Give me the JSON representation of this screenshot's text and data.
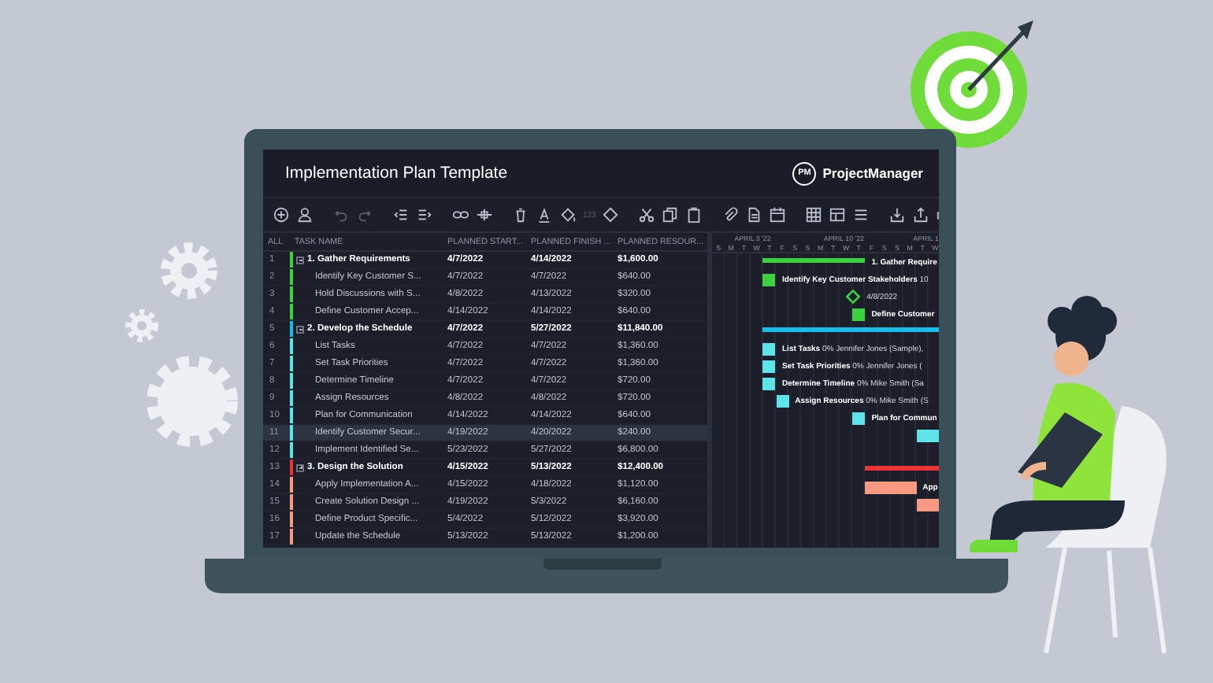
{
  "window": {
    "title": "Implementation Plan Template",
    "brand": {
      "badge": "PM",
      "name": "ProjectManager"
    }
  },
  "toolbar": {
    "number_format": "123"
  },
  "table": {
    "columns": [
      "ALL",
      "TASK NAME",
      "PLANNED START...",
      "PLANNED FINISH ...",
      "PLANNED RESOUR..."
    ],
    "rows": [
      {
        "num": "1",
        "task": "1. Gather Requirements",
        "start": "4/7/2022",
        "finish": "4/14/2022",
        "resource": "$1,600.00",
        "kind": "summary",
        "color": "#3dd13f",
        "selected": false,
        "expanded": true,
        "gantt_label": {
          "name": "1. Gather Require"
        }
      },
      {
        "num": "2",
        "task": "Identify Key Customer S...",
        "start": "4/7/2022",
        "finish": "4/7/2022",
        "resource": "$640.00",
        "kind": "task",
        "color": "#3dd13f",
        "selected": false,
        "gantt_label": {
          "name": "Identify Key Customer Stakeholders",
          "detail": "10"
        }
      },
      {
        "num": "3",
        "task": "Hold Discussions with S...",
        "start": "4/8/2022",
        "finish": "4/13/2022",
        "resource": "$320.00",
        "kind": "milestone",
        "color": "#3dd13f",
        "selected": false,
        "gantt_label": {
          "detail": "4/8/2022"
        }
      },
      {
        "num": "4",
        "task": "Define Customer Accep...",
        "start": "4/14/2022",
        "finish": "4/14/2022",
        "resource": "$640.00",
        "kind": "task",
        "color": "#3dd13f",
        "selected": false,
        "gantt_label": {
          "name": "Define Customer"
        }
      },
      {
        "num": "5",
        "task": "2. Develop the Schedule",
        "start": "4/7/2022",
        "finish": "5/27/2022",
        "resource": "$11,840.00",
        "kind": "summary",
        "color": "#1bbde6",
        "selected": false,
        "expanded": true
      },
      {
        "num": "6",
        "task": "List Tasks",
        "start": "4/7/2022",
        "finish": "4/7/2022",
        "resource": "$1,360.00",
        "kind": "task",
        "color": "#5ee3ea",
        "selected": false,
        "gantt_label": {
          "name": "List Tasks",
          "detail": "0%  Jennifer Jones (Sample),"
        }
      },
      {
        "num": "7",
        "task": "Set Task Priorities",
        "start": "4/7/2022",
        "finish": "4/7/2022",
        "resource": "$1,360.00",
        "kind": "task",
        "color": "#5ee3ea",
        "selected": false,
        "gantt_label": {
          "name": "Set Task Priorities",
          "detail": "0%  Jennifer Jones ("
        }
      },
      {
        "num": "8",
        "task": "Determine Timeline",
        "start": "4/7/2022",
        "finish": "4/7/2022",
        "resource": "$720.00",
        "kind": "task",
        "color": "#5ee3ea",
        "selected": false,
        "gantt_label": {
          "name": "Determine Timeline",
          "detail": "0%  Mike Smith (Sa"
        }
      },
      {
        "num": "9",
        "task": "Assign Resources",
        "start": "4/8/2022",
        "finish": "4/8/2022",
        "resource": "$720.00",
        "kind": "task",
        "color": "#5ee3ea",
        "selected": false,
        "gantt_label": {
          "name": "Assign Resources",
          "detail": "0%  Mike Smith (S"
        }
      },
      {
        "num": "10",
        "task": "Plan for Communication",
        "start": "4/14/2022",
        "finish": "4/14/2022",
        "resource": "$640.00",
        "kind": "task",
        "color": "#5ee3ea",
        "selected": false,
        "gantt_label": {
          "name": "Plan for Commun"
        }
      },
      {
        "num": "11",
        "task": "Identify Customer Secur...",
        "start": "4/19/2022",
        "finish": "4/20/2022",
        "resource": "$240.00",
        "kind": "task",
        "color": "#5ee3ea",
        "selected": true
      },
      {
        "num": "12",
        "task": "Implement Identified Se...",
        "start": "5/23/2022",
        "finish": "5/27/2022",
        "resource": "$6,800.00",
        "kind": "task",
        "color": "#5ee3ea",
        "selected": false
      },
      {
        "num": "13",
        "task": "3. Design the Solution",
        "start": "4/15/2022",
        "finish": "5/13/2022",
        "resource": "$12,400.00",
        "kind": "summary",
        "color": "#ee3333",
        "selected": false,
        "expanded": false
      },
      {
        "num": "14",
        "task": "Apply Implementation A...",
        "start": "4/15/2022",
        "finish": "4/18/2022",
        "resource": "$1,120.00",
        "kind": "task",
        "color": "#f89a82",
        "selected": false,
        "gantt_label": {
          "name": "App"
        }
      },
      {
        "num": "15",
        "task": "Create Solution Design ...",
        "start": "4/19/2022",
        "finish": "5/3/2022",
        "resource": "$6,160.00",
        "kind": "task",
        "color": "#f89a82",
        "selected": false
      },
      {
        "num": "16",
        "task": "Define Product Specific...",
        "start": "5/4/2022",
        "finish": "5/12/2022",
        "resource": "$3,920.00",
        "kind": "task",
        "color": "#f89a82",
        "selected": false
      },
      {
        "num": "17",
        "task": "Update the Schedule",
        "start": "5/13/2022",
        "finish": "5/13/2022",
        "resource": "$1,200.00",
        "kind": "task",
        "color": "#f89a82",
        "selected": false
      }
    ]
  },
  "gantt": {
    "months": [
      "APRIL 3 '22",
      "APRIL 10 '22",
      "APRIL 1"
    ],
    "days": [
      "S",
      "M",
      "T",
      "W",
      "T",
      "F",
      "S",
      "S",
      "M",
      "T",
      "W",
      "T",
      "F",
      "S",
      "S",
      "M",
      "T",
      "W"
    ]
  }
}
